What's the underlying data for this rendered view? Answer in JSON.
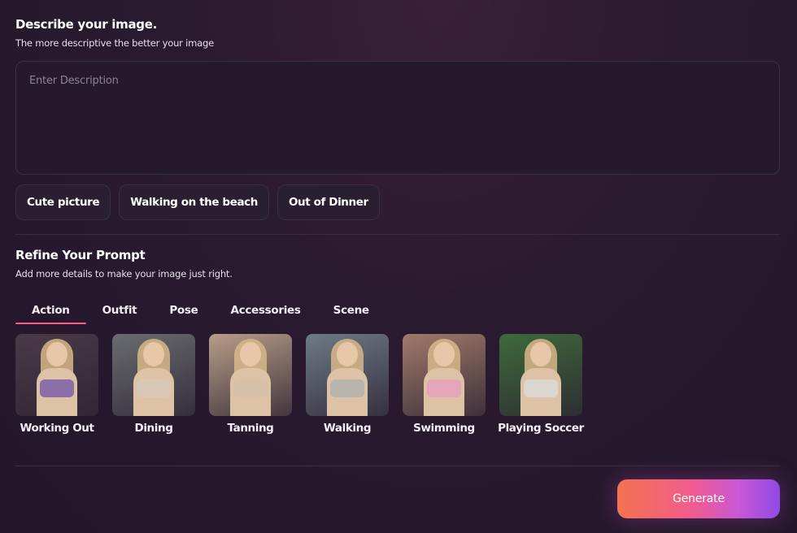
{
  "describe": {
    "title": "Describe your image.",
    "subtitle": "The more descriptive the better your image",
    "placeholder": "Enter Description",
    "value": ""
  },
  "chips": [
    {
      "label": "Cute picture"
    },
    {
      "label": "Walking on the beach"
    },
    {
      "label": "Out of Dinner"
    }
  ],
  "refine": {
    "title": "Refine Your Prompt",
    "subtitle": "Add more details to make your image just right."
  },
  "tabs": [
    {
      "label": "Action",
      "active": true
    },
    {
      "label": "Outfit",
      "active": false
    },
    {
      "label": "Pose",
      "active": false
    },
    {
      "label": "Accessories",
      "active": false
    },
    {
      "label": "Scene",
      "active": false
    }
  ],
  "options": [
    {
      "label": "Working Out",
      "bg": "#4a3a48",
      "accent": "#8b6fa8"
    },
    {
      "label": "Dining",
      "bg": "#6a6c70",
      "accent": "#d9c8b8"
    },
    {
      "label": "Tanning",
      "bg": "#b89c88",
      "accent": "#d7c0a8"
    },
    {
      "label": "Walking",
      "bg": "#6e7a86",
      "accent": "#b8b4ae"
    },
    {
      "label": "Swimming",
      "bg": "#a07a6a",
      "accent": "#e2a6b8"
    },
    {
      "label": "Playing Soccer",
      "bg": "#3e6a3c",
      "accent": "#dcd6d0"
    }
  ],
  "actions": {
    "generate_label": "Generate"
  }
}
